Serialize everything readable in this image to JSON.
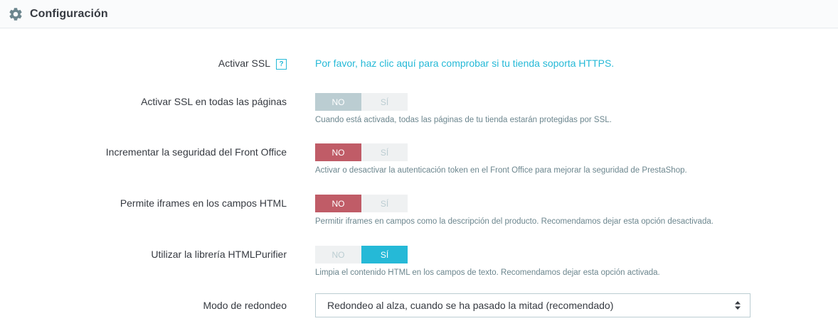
{
  "header": {
    "title": "Configuración",
    "icon": "gear-icon"
  },
  "colors": {
    "accent": "#25b9d7",
    "danger": "#c05c67",
    "muted": "#bbcdd2"
  },
  "ssl": {
    "label": "Activar SSL",
    "help": "?",
    "link": "Por favor, haz clic aquí para comprobar si tu tienda soporta HTTPS."
  },
  "ssl_all": {
    "label": "Activar SSL en todas las páginas",
    "no": "NO",
    "yes": "SÍ",
    "selected": "NO",
    "disabled": true,
    "hint": "Cuando está activada, todas las páginas de tu tienda estarán protegidas por SSL."
  },
  "front_security": {
    "label": "Incrementar la seguridad del Front Office",
    "no": "NO",
    "yes": "SÍ",
    "selected": "NO",
    "hint": "Activar o desactivar la autenticación token en el Front Office para mejorar la seguridad de PrestaShop."
  },
  "iframes": {
    "label": "Permite iframes en los campos HTML",
    "no": "NO",
    "yes": "SÍ",
    "selected": "NO",
    "hint": "Permitir iframes en campos como la descripción del producto. Recomendamos dejar esta opción desactivada."
  },
  "purifier": {
    "label": "Utilizar la librería HTMLPurifier",
    "no": "NO",
    "yes": "SÍ",
    "selected": "SÍ",
    "hint": "Limpia el contenido HTML en los campos de texto. Recomendamos dejar esta opción activada."
  },
  "rounding": {
    "label": "Modo de redondeo",
    "value": "Redondeo al alza, cuando se ha pasado la mitad (recomendado)"
  }
}
